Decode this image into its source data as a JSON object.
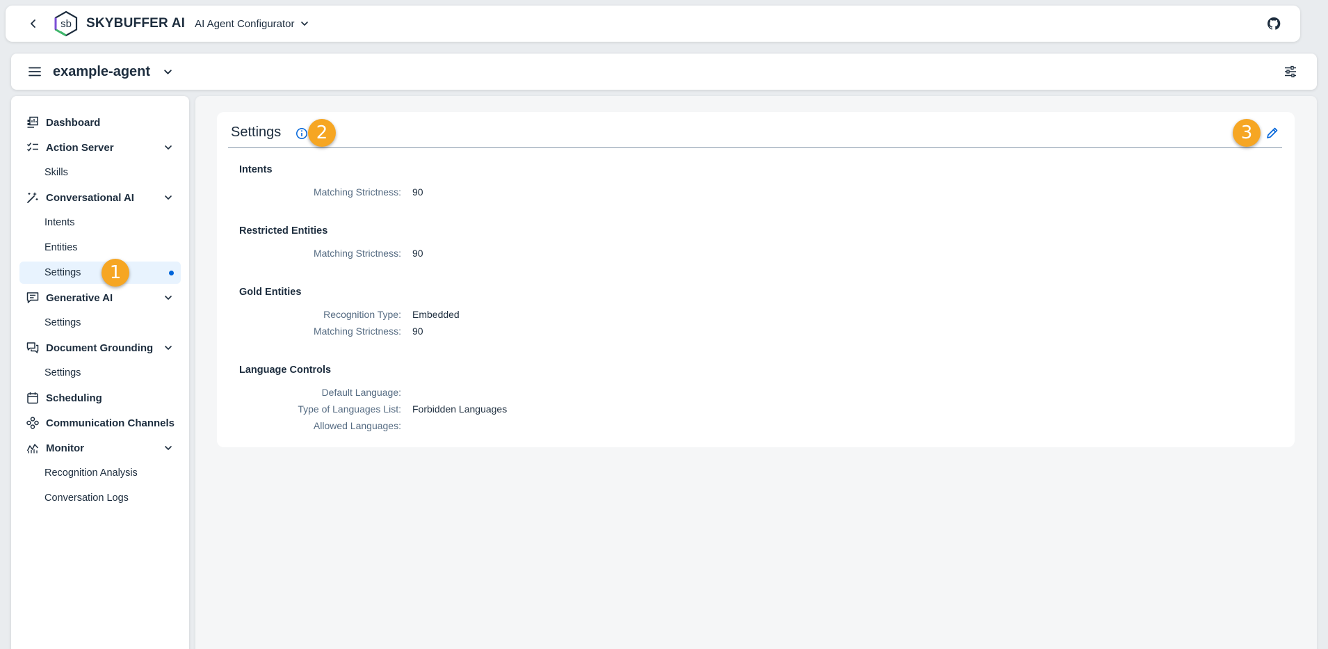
{
  "shell": {
    "brand": "SKYBUFFER AI",
    "logo_text": "sb",
    "app_name": "AI Agent Configurator"
  },
  "agent": {
    "name": "example-agent"
  },
  "sidebar": {
    "items": [
      {
        "label": "Dashboard"
      },
      {
        "label": "Action Server"
      },
      {
        "label": "Skills"
      },
      {
        "label": "Conversational AI"
      },
      {
        "label": "Intents"
      },
      {
        "label": "Entities"
      },
      {
        "label": "Settings"
      },
      {
        "label": "Generative AI"
      },
      {
        "label": "Settings"
      },
      {
        "label": "Document Grounding"
      },
      {
        "label": "Settings"
      },
      {
        "label": "Scheduling"
      },
      {
        "label": "Communication Channels"
      },
      {
        "label": "Monitor"
      },
      {
        "label": "Recognition Analysis"
      },
      {
        "label": "Conversation Logs"
      }
    ]
  },
  "settings": {
    "title": "Settings",
    "sections": {
      "intents": {
        "title": "Intents",
        "matching_strictness_label": "Matching Strictness:",
        "matching_strictness_value": "90"
      },
      "restricted_entities": {
        "title": "Restricted Entities",
        "matching_strictness_label": "Matching Strictness:",
        "matching_strictness_value": "90"
      },
      "gold_entities": {
        "title": "Gold Entities",
        "recognition_type_label": "Recognition Type:",
        "recognition_type_value": "Embedded",
        "matching_strictness_label": "Matching Strictness:",
        "matching_strictness_value": "90"
      },
      "language_controls": {
        "title": "Language Controls",
        "default_language_label": "Default Language:",
        "default_language_value": "",
        "list_type_label": "Type of Languages List:",
        "list_type_value": "Forbidden Languages",
        "allowed_languages_label": "Allowed Languages:",
        "allowed_languages_value": ""
      }
    }
  },
  "annotations": [
    "1",
    "2",
    "3"
  ],
  "colors": {
    "accent": "#0064d9",
    "badge": "#f6a623",
    "selected_bg": "#e8f3fe",
    "label": "#556b82"
  }
}
